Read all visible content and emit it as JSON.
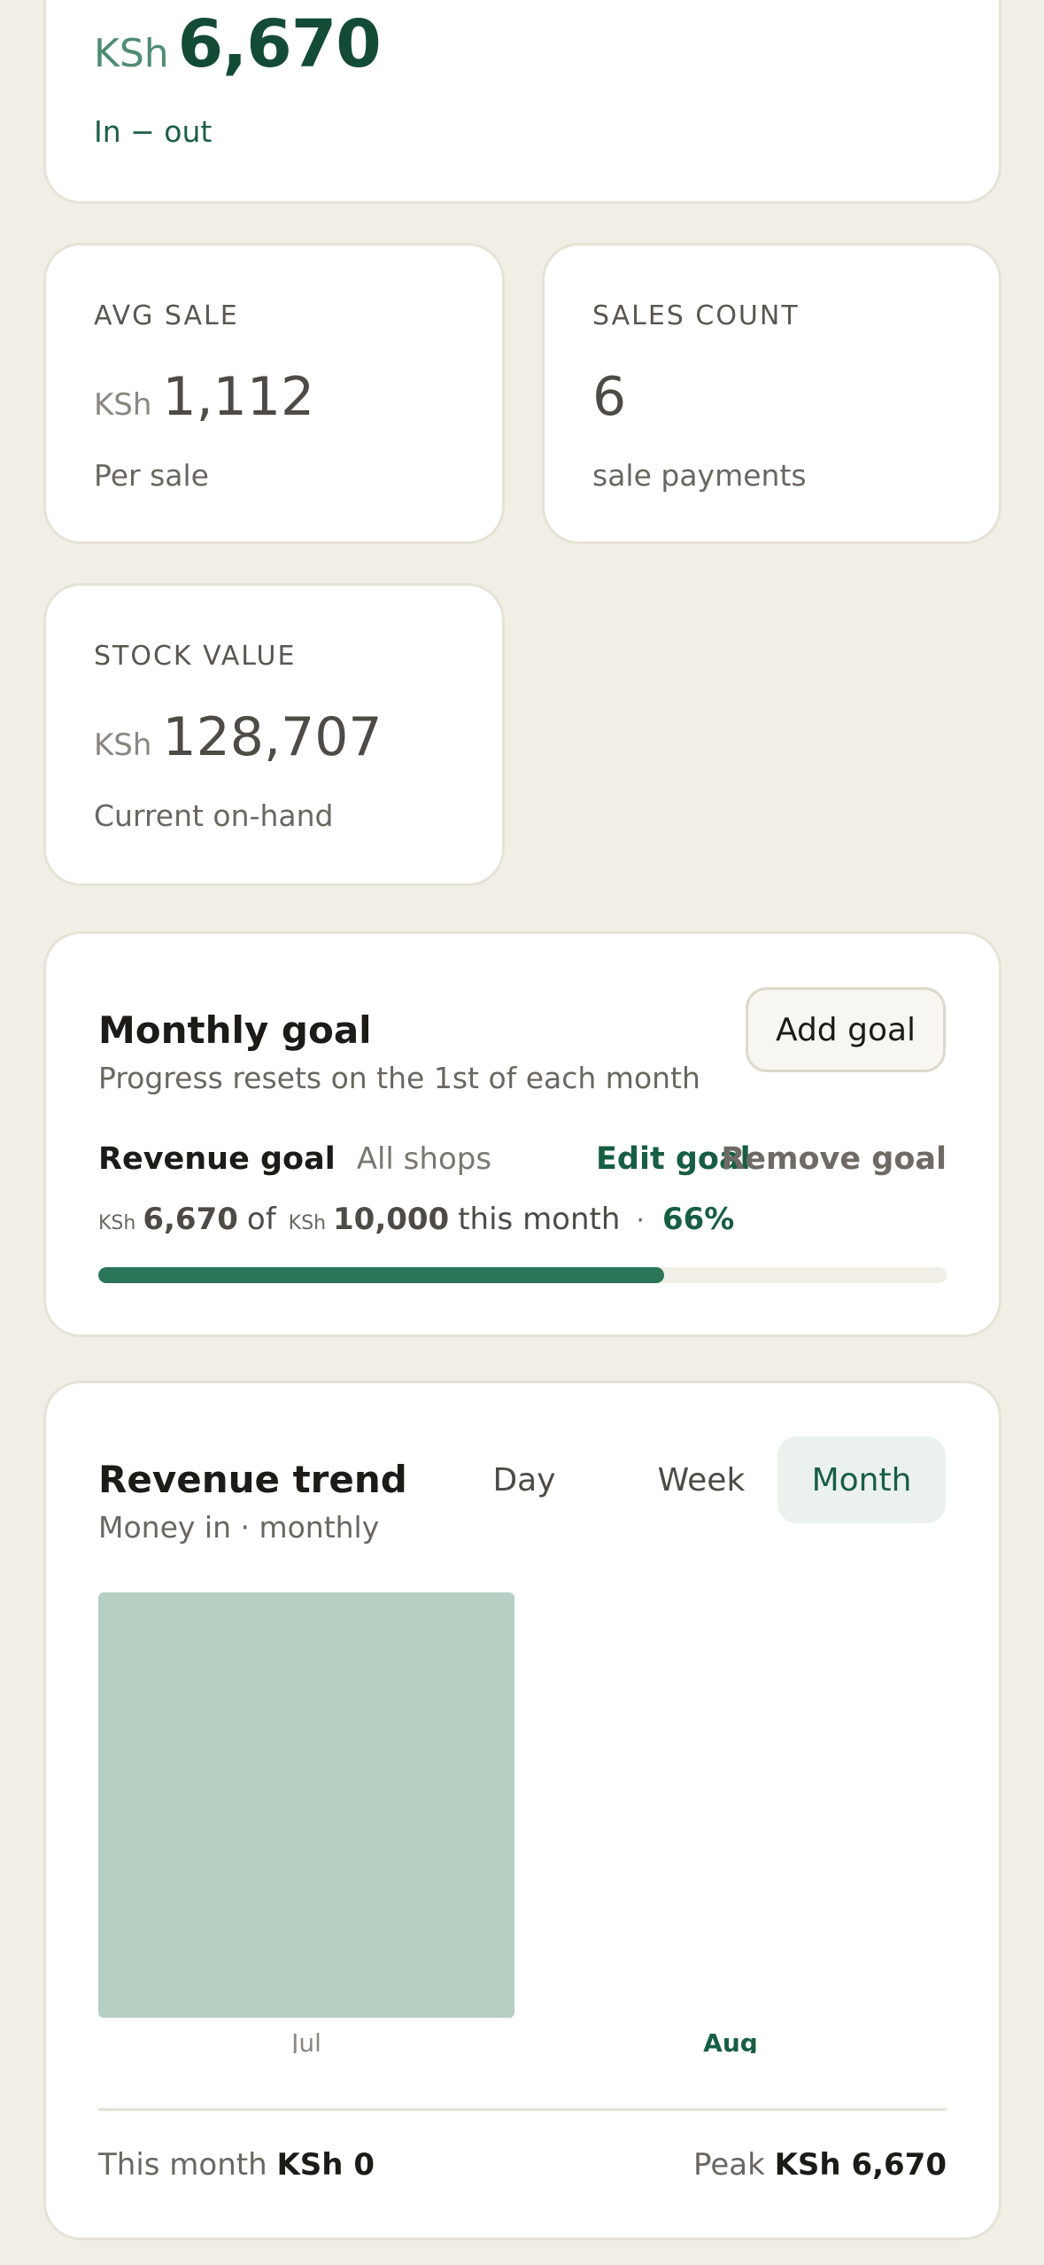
{
  "net": {
    "currency": "KSh",
    "value": "6,670",
    "subtitle": "In − out"
  },
  "stats": {
    "avg_sale": {
      "label": "AVG SALE",
      "currency": "KSh",
      "value": "1,112",
      "sub": "Per sale"
    },
    "sales_count": {
      "label": "SALES COUNT",
      "value": "6",
      "sub": "sale payments"
    },
    "stock_value": {
      "label": "STOCK VALUE",
      "currency": "KSh",
      "value": "128,707",
      "sub": "Current on-hand"
    }
  },
  "goal": {
    "title": "Monthly goal",
    "subtitle": "Progress resets on the 1st of each month",
    "add_label": "Add goal",
    "name": "Revenue goal",
    "scope": "All shops",
    "edit_label": "Edit goal",
    "remove_label": "Remove goal",
    "current_currency": "KSh",
    "current": "6,670",
    "of_word": "of",
    "target_currency": "KSh",
    "target": "10,000",
    "period_text": "this month",
    "dot": "·",
    "percent_label": "66%",
    "progress_fraction": 0.667,
    "accent_color": "#2a7558"
  },
  "trend": {
    "title": "Revenue trend",
    "subtitle": "Money in · monthly",
    "tabs": [
      "Day",
      "Week",
      "Month"
    ],
    "active_tab": "Month",
    "footer_left_label": "This month",
    "footer_left_value": "KSh 0",
    "footer_right_label": "Peak",
    "footer_right_value": "KSh 6,670"
  },
  "chart_data": {
    "type": "bar",
    "categories": [
      "Jul",
      "Aug"
    ],
    "values": [
      6670,
      0
    ],
    "highlight_category": "Aug",
    "bar_color": "#b5cfc3",
    "label_color": "#8a8680",
    "highlight_label_color": "#175e43",
    "title": "",
    "xlabel": "",
    "ylabel": ""
  }
}
